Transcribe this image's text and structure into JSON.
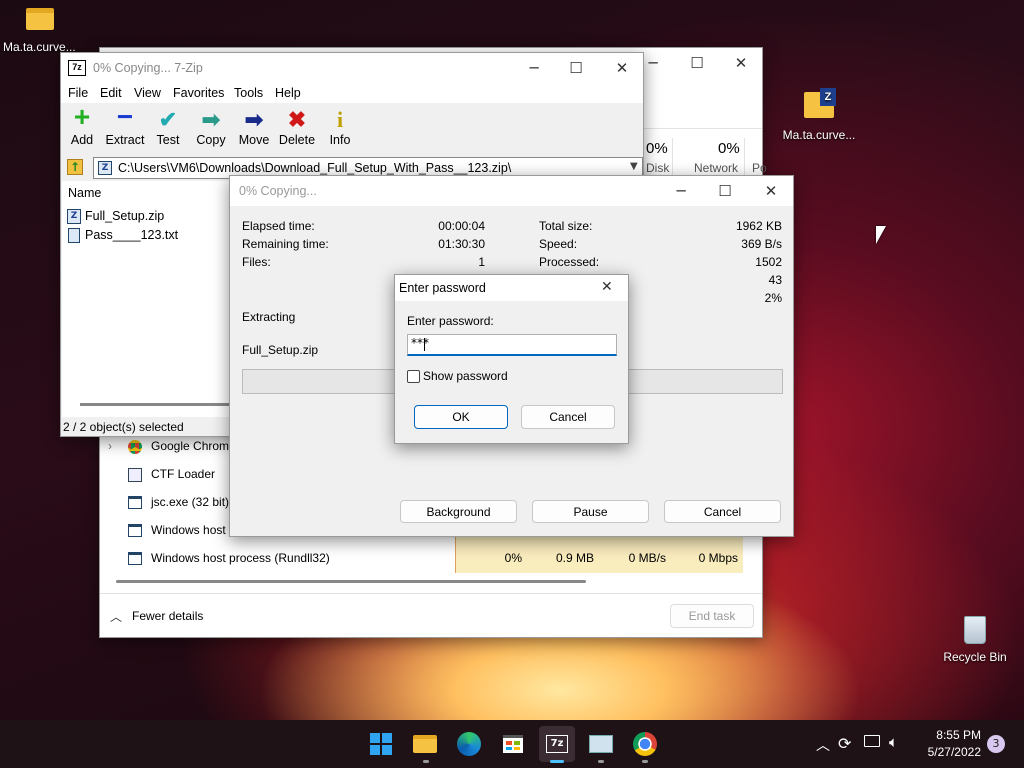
{
  "desktop": {
    "icon1_label": "Ma.ta.curve...",
    "icon2_label": "Ma.ta.curve...",
    "recycle_label": "Recycle Bin"
  },
  "taskmgr": {
    "col_disk_pct": "0%",
    "col_disk": "Disk",
    "col_net_pct": "0%",
    "col_net": "Network",
    "col_power": "Po",
    "processes": [
      "Google Chrome",
      "CTF Loader",
      "jsc.exe (32 bit)",
      "Windows host p",
      "Windows host process (Rundll32)"
    ],
    "last_row": {
      "cpu": "0%",
      "memory": "0.9 MB",
      "disk": "0 MB/s",
      "network": "0 Mbps"
    },
    "fewer_details": "Fewer details",
    "end_task": "End task"
  },
  "zipfm": {
    "title": "0% Copying... 7-Zip",
    "menu": [
      "File",
      "Edit",
      "View",
      "Favorites",
      "Tools",
      "Help"
    ],
    "toolbar": [
      "Add",
      "Extract",
      "Test",
      "Copy",
      "Move",
      "Delete",
      "Info"
    ],
    "path": "C:\\Users\\VM6\\Downloads\\Download_Full_Setup_With_Pass__123.zip\\",
    "col_name": "Name",
    "files": [
      "Full_Setup.zip",
      "Pass____123.txt"
    ],
    "status": "2 / 2 object(s) selected"
  },
  "progress": {
    "title": "0% Copying...",
    "elapsed_label": "Elapsed time:",
    "elapsed": "00:00:04",
    "remaining_label": "Remaining time:",
    "remaining": "01:30:30",
    "files_label": "Files:",
    "files": "1",
    "total_label": "Total size:",
    "total": "1962 KB",
    "speed_label": "Speed:",
    "speed": "369 B/s",
    "processed_label": "Processed:",
    "processed": "1502",
    "val4": "43",
    "val5": "2%",
    "action": "Extracting",
    "current_file": "Full_Setup.zip",
    "background": "Background",
    "pause": "Pause",
    "cancel": "Cancel"
  },
  "password": {
    "title": "Enter password",
    "label": "Enter password:",
    "value": "***",
    "show": "Show password",
    "ok": "OK",
    "cancel": "Cancel"
  },
  "taskbar": {
    "time": "8:55 PM",
    "date": "5/27/2022",
    "badge": "3"
  },
  "colors": {
    "accent": "#0067c0",
    "task_highlight": "#f9ecbd"
  }
}
